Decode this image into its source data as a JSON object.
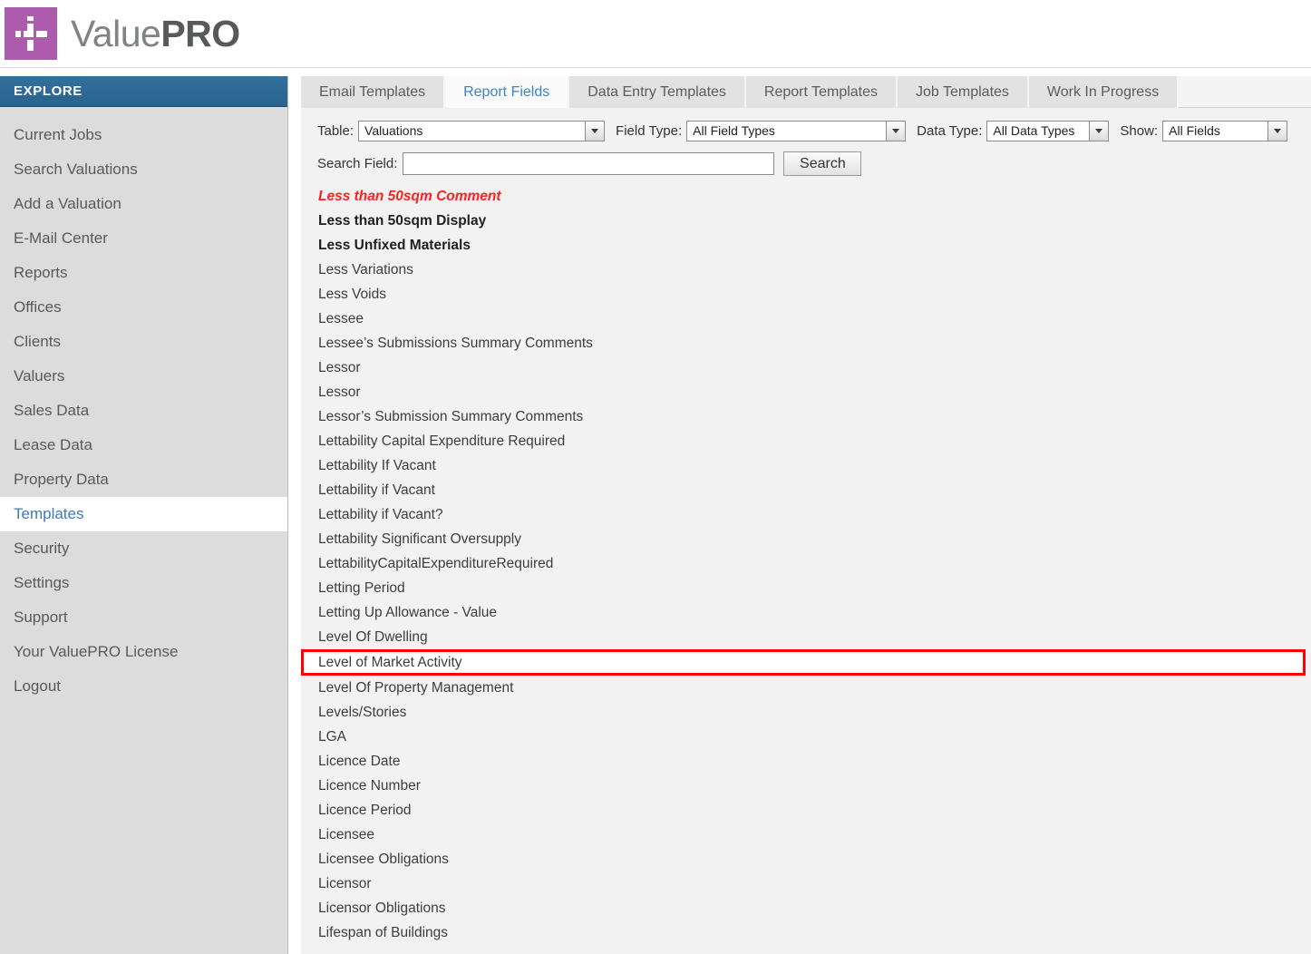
{
  "brand": {
    "logo_icon": "valuepro-cross-icon",
    "name_light": "Value",
    "name_bold": "PRO",
    "logo_color": "#ad5bad"
  },
  "sidebar": {
    "header": "EXPLORE",
    "header_color": "#2e6da4",
    "active_item": "Templates",
    "items": [
      {
        "label": "Current Jobs"
      },
      {
        "label": "Search Valuations"
      },
      {
        "label": "Add a Valuation"
      },
      {
        "label": "E-Mail Center"
      },
      {
        "label": "Reports"
      },
      {
        "label": "Offices"
      },
      {
        "label": "Clients"
      },
      {
        "label": "Valuers"
      },
      {
        "label": "Sales Data"
      },
      {
        "label": "Lease Data"
      },
      {
        "label": "Property Data"
      },
      {
        "label": "Templates"
      },
      {
        "label": "Security"
      },
      {
        "label": "Settings"
      },
      {
        "label": "Support"
      },
      {
        "label": "Your ValuePRO License"
      },
      {
        "label": "Logout"
      }
    ]
  },
  "tabs": [
    {
      "label": "Email Templates",
      "active": false
    },
    {
      "label": "Report Fields",
      "active": true
    },
    {
      "label": "Data Entry Templates",
      "active": false
    },
    {
      "label": "Report Templates",
      "active": false
    },
    {
      "label": "Job Templates",
      "active": false
    },
    {
      "label": "Work In Progress",
      "active": false
    }
  ],
  "filters": {
    "table_label": "Table:",
    "table_value": "Valuations",
    "field_type_label": "Field Type:",
    "field_type_value": "All Field Types",
    "data_type_label": "Data Type:",
    "data_type_value": "All Data Types",
    "show_label": "Show:",
    "show_value": "All Fields"
  },
  "search": {
    "label": "Search Field:",
    "value": "",
    "placeholder": "",
    "button": "Search"
  },
  "field_list": {
    "highlight_color": "#ff0000",
    "rows": [
      {
        "label": "Less than 50sqm Comment",
        "style": "red"
      },
      {
        "label": "Less than 50sqm Display",
        "style": "strong"
      },
      {
        "label": "Less Unfixed Materials",
        "style": "strong"
      },
      {
        "label": "Less Variations",
        "style": "normal"
      },
      {
        "label": "Less Voids",
        "style": "normal"
      },
      {
        "label": "Lessee",
        "style": "normal"
      },
      {
        "label": "Lessee’s Submissions Summary Comments",
        "style": "normal"
      },
      {
        "label": "Lessor",
        "style": "normal"
      },
      {
        "label": "Lessor",
        "style": "normal"
      },
      {
        "label": "Lessor’s Submission Summary Comments",
        "style": "normal"
      },
      {
        "label": "Lettability Capital Expenditure Required",
        "style": "normal"
      },
      {
        "label": "Lettability If Vacant",
        "style": "normal"
      },
      {
        "label": "Lettability if Vacant",
        "style": "normal"
      },
      {
        "label": "Lettability if Vacant?",
        "style": "normal"
      },
      {
        "label": "Lettability Significant Oversupply",
        "style": "normal"
      },
      {
        "label": "LettabilityCapitalExpenditureRequired",
        "style": "normal"
      },
      {
        "label": "Letting Period",
        "style": "normal"
      },
      {
        "label": "Letting Up Allowance - Value",
        "style": "normal"
      },
      {
        "label": "Level Of Dwelling",
        "style": "normal"
      },
      {
        "label": "Level of Market Activity",
        "style": "highlight"
      },
      {
        "label": "Level Of Property Management",
        "style": "normal"
      },
      {
        "label": "Levels/Stories",
        "style": "normal"
      },
      {
        "label": "LGA",
        "style": "normal"
      },
      {
        "label": "Licence Date",
        "style": "normal"
      },
      {
        "label": "Licence Number",
        "style": "normal"
      },
      {
        "label": "Licence Period",
        "style": "normal"
      },
      {
        "label": "Licensee",
        "style": "normal"
      },
      {
        "label": "Licensee Obligations",
        "style": "normal"
      },
      {
        "label": "Licensor",
        "style": "normal"
      },
      {
        "label": "Licensor Obligations",
        "style": "normal"
      },
      {
        "label": "Lifespan of Buildings",
        "style": "normal"
      }
    ]
  }
}
